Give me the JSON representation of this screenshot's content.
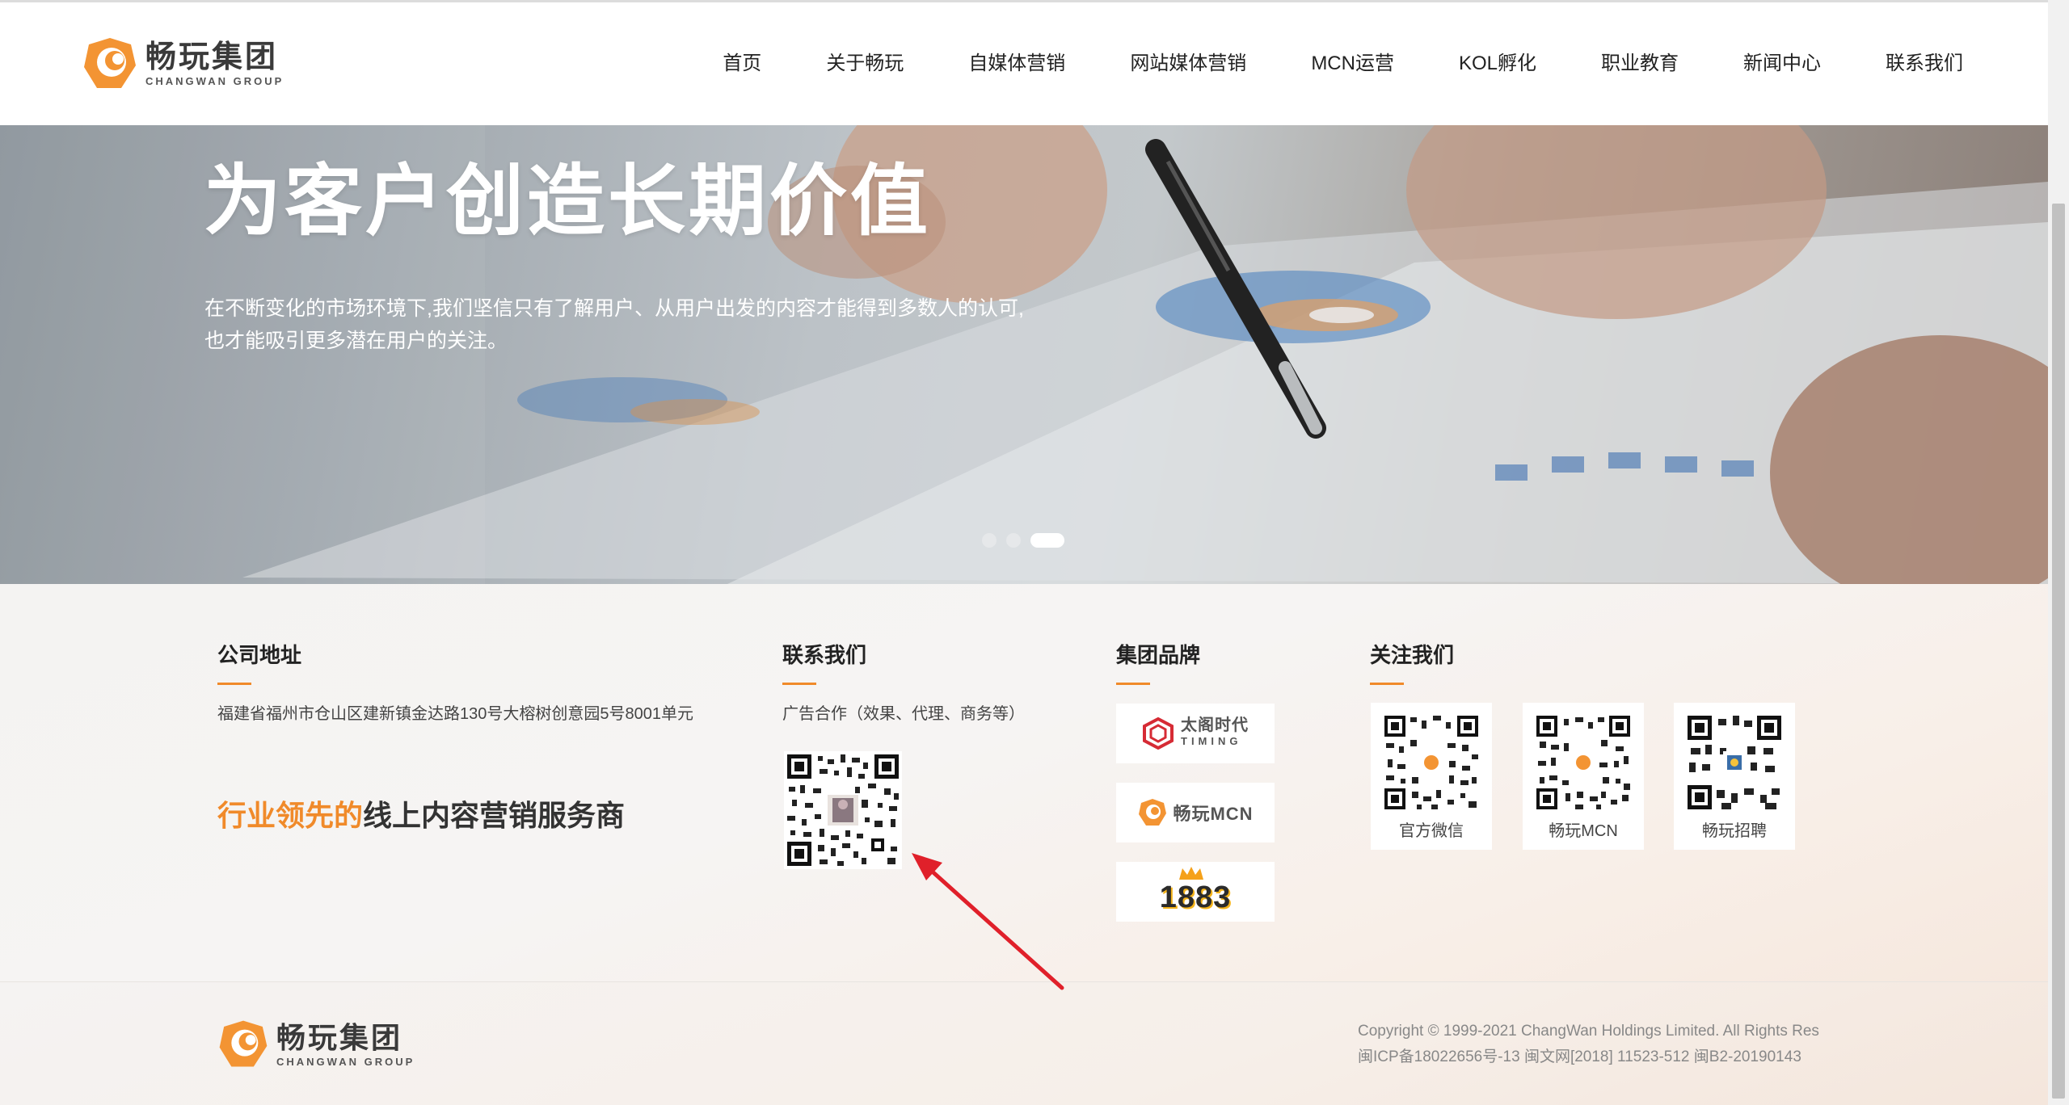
{
  "header": {
    "logo_cn": "畅玩集团",
    "logo_en": "CHANGWAN GROUP",
    "nav": [
      "首页",
      "关于畅玩",
      "自媒体营销",
      "网站媒体营销",
      "MCN运营",
      "KOL孵化",
      "职业教育",
      "新闻中心",
      "联系我们"
    ]
  },
  "hero": {
    "title_line": "为客户创造长期价值",
    "desc": "在不断变化的市场环境下,我们坚信只有了解用户、从用户出发的内容才能得到多数人的认可,也才能吸引更多潜在用户的关注。",
    "slide_count": 3,
    "active_slide": 3
  },
  "footer": {
    "address": {
      "title": "公司地址",
      "text": "福建省福州市仓山区建新镇金达路130号大榕树创意园5号8001单元",
      "slogan_highlight": "行业领先的",
      "slogan_rest": "线上内容营销服务商"
    },
    "contact": {
      "title": "联系我们",
      "text": "广告合作（效果、代理、商务等）"
    },
    "brands": {
      "title": "集团品牌",
      "items": [
        {
          "name": "太阁时代",
          "sub": "TIMING"
        },
        {
          "name": "畅玩MCN"
        },
        {
          "name": "1883"
        }
      ]
    },
    "follow": {
      "title": "关注我们",
      "items": [
        "官方微信",
        "畅玩MCN",
        "畅玩招聘"
      ]
    }
  },
  "bottom": {
    "logo_cn": "畅玩集团",
    "logo_en": "CHANGWAN GROUP",
    "copyright": "Copyright © 1999-2021 ChangWan Holdings Limited. All Rights Res",
    "icp": "闽ICP备18022656号-13 闽文网[2018] 11523-512 闽B2-20190143"
  },
  "colors": {
    "accent": "#f08a2a",
    "arrow": "#e0202a"
  }
}
